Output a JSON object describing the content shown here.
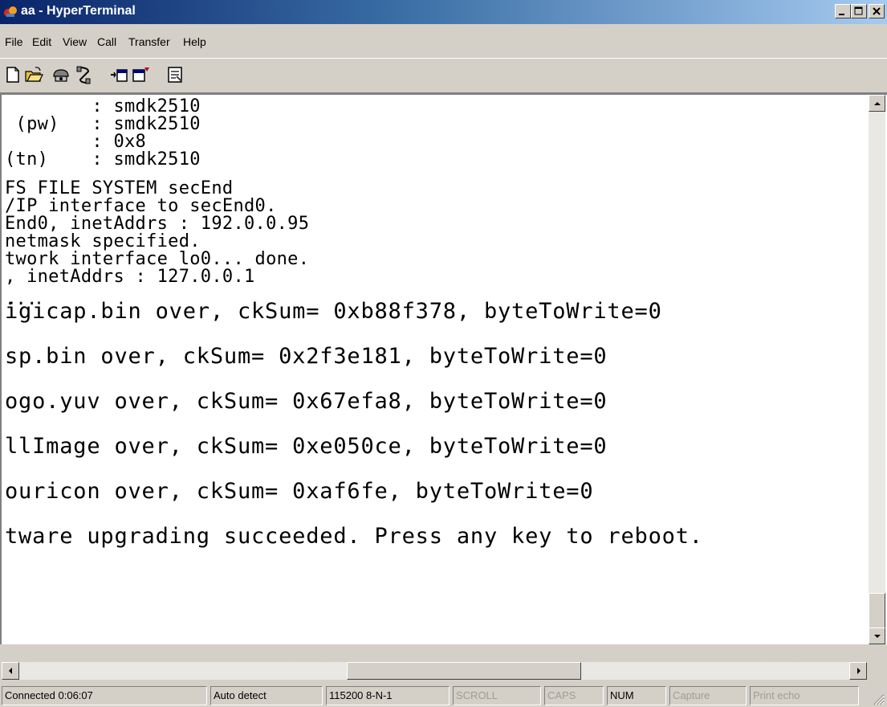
{
  "window": {
    "title": "aa - HyperTerminal"
  },
  "menu": {
    "items": [
      "File",
      "Edit",
      "View",
      "Call",
      "Transfer",
      "Help"
    ]
  },
  "toolbar": {
    "buttons": [
      "new-icon",
      "open-icon",
      "connect-icon",
      "disconnect-icon",
      "send-icon",
      "receive-icon",
      "properties-icon"
    ]
  },
  "terminal": {
    "lines": [
      "        : smdk2510",
      " (pw)   : smdk2510",
      "        : 0x8",
      "(tn)    : smdk2510",
      "FS FILE SYSTEM secEnd",
      "/IP interface to secEnd0.",
      "End0, inetAddrs : 192.0.0.95",
      "netmask specified.",
      "twork interface lo0... done.",
      ", inetAddrs : 127.0.0.1",
      "...",
      "igicap.bin over, ckSum= 0xb88f378, byteToWrite=0",
      "sp.bin over, ckSum= 0x2f3e181, byteToWrite=0",
      "ogo.yuv over, ckSum= 0x67efa8, byteToWrite=0",
      "llImage over, ckSum= 0xe050ce, byteToWrite=0",
      "ouricon over, ckSum= 0xaf6fe, byteToWrite=0",
      "tware upgrading succeeded. Press any key to reboot."
    ]
  },
  "status": {
    "connected": "Connected 0:06:07",
    "detect": "Auto detect",
    "port": "115200 8-N-1",
    "scroll": "SCROLL",
    "caps": "CAPS",
    "num": "NUM",
    "capture": "Capture",
    "print_echo": "Print echo"
  }
}
